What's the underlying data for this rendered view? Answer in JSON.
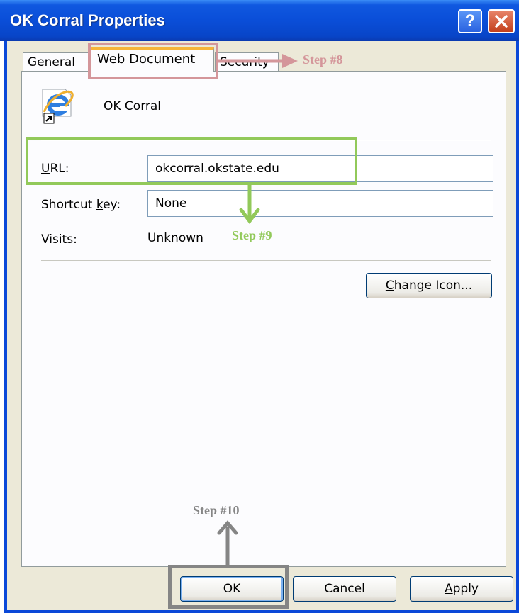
{
  "window": {
    "title": "OK Corral Properties",
    "help_label": "?"
  },
  "tabs": [
    {
      "label": "General"
    },
    {
      "label": "Web Document",
      "selected": true
    },
    {
      "label": "Security"
    }
  ],
  "document": {
    "icon": "internet-explorer-shortcut-icon",
    "name": "OK Corral"
  },
  "fields": {
    "url_label_key": "U",
    "url_label_rest": "RL:",
    "url_value": "okcorral.okstate.edu",
    "shortcut_label_pre": "Shortcut ",
    "shortcut_label_key": "k",
    "shortcut_label_post": "ey:",
    "shortcut_value": "None",
    "visits_label": "Visits:",
    "visits_value": "Unknown"
  },
  "buttons": {
    "change_icon_key": "C",
    "change_icon_rest": "hange Icon...",
    "ok": "OK",
    "cancel": "Cancel",
    "apply_key": "A",
    "apply_rest": "pply"
  },
  "annotations": {
    "step8": "Step #8",
    "step9": "Step #9",
    "step10": "Step #10"
  },
  "colors": {
    "titlebar": "#0a4ed8",
    "step8": "#d4969a",
    "step9": "#92c95a",
    "step10": "#858585"
  }
}
